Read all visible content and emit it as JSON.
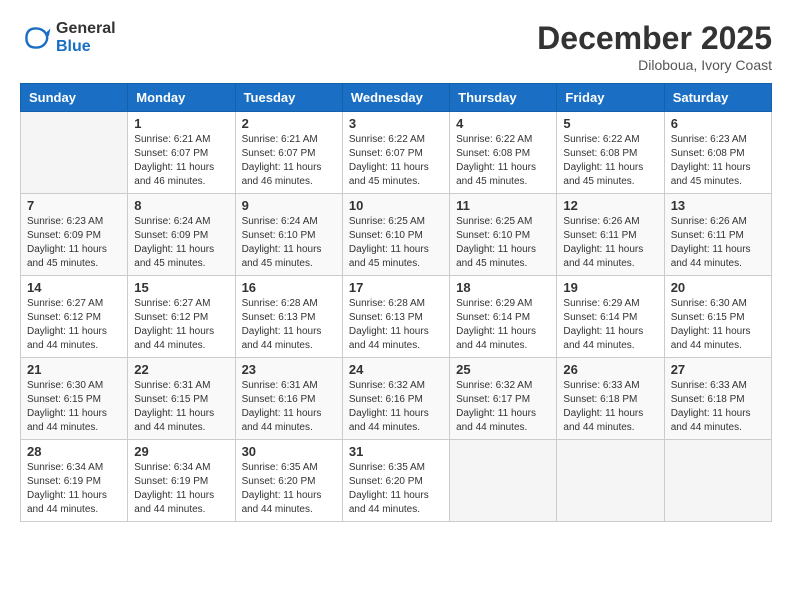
{
  "header": {
    "logo_general": "General",
    "logo_blue": "Blue",
    "month_year": "December 2025",
    "location": "Diloboua, Ivory Coast"
  },
  "columns": [
    "Sunday",
    "Monday",
    "Tuesday",
    "Wednesday",
    "Thursday",
    "Friday",
    "Saturday"
  ],
  "weeks": [
    [
      {
        "day": "",
        "sunrise": "",
        "sunset": "",
        "daylight": ""
      },
      {
        "day": "1",
        "sunrise": "Sunrise: 6:21 AM",
        "sunset": "Sunset: 6:07 PM",
        "daylight": "Daylight: 11 hours and 46 minutes."
      },
      {
        "day": "2",
        "sunrise": "Sunrise: 6:21 AM",
        "sunset": "Sunset: 6:07 PM",
        "daylight": "Daylight: 11 hours and 46 minutes."
      },
      {
        "day": "3",
        "sunrise": "Sunrise: 6:22 AM",
        "sunset": "Sunset: 6:07 PM",
        "daylight": "Daylight: 11 hours and 45 minutes."
      },
      {
        "day": "4",
        "sunrise": "Sunrise: 6:22 AM",
        "sunset": "Sunset: 6:08 PM",
        "daylight": "Daylight: 11 hours and 45 minutes."
      },
      {
        "day": "5",
        "sunrise": "Sunrise: 6:22 AM",
        "sunset": "Sunset: 6:08 PM",
        "daylight": "Daylight: 11 hours and 45 minutes."
      },
      {
        "day": "6",
        "sunrise": "Sunrise: 6:23 AM",
        "sunset": "Sunset: 6:08 PM",
        "daylight": "Daylight: 11 hours and 45 minutes."
      }
    ],
    [
      {
        "day": "7",
        "sunrise": "Sunrise: 6:23 AM",
        "sunset": "Sunset: 6:09 PM",
        "daylight": "Daylight: 11 hours and 45 minutes."
      },
      {
        "day": "8",
        "sunrise": "Sunrise: 6:24 AM",
        "sunset": "Sunset: 6:09 PM",
        "daylight": "Daylight: 11 hours and 45 minutes."
      },
      {
        "day": "9",
        "sunrise": "Sunrise: 6:24 AM",
        "sunset": "Sunset: 6:10 PM",
        "daylight": "Daylight: 11 hours and 45 minutes."
      },
      {
        "day": "10",
        "sunrise": "Sunrise: 6:25 AM",
        "sunset": "Sunset: 6:10 PM",
        "daylight": "Daylight: 11 hours and 45 minutes."
      },
      {
        "day": "11",
        "sunrise": "Sunrise: 6:25 AM",
        "sunset": "Sunset: 6:10 PM",
        "daylight": "Daylight: 11 hours and 45 minutes."
      },
      {
        "day": "12",
        "sunrise": "Sunrise: 6:26 AM",
        "sunset": "Sunset: 6:11 PM",
        "daylight": "Daylight: 11 hours and 44 minutes."
      },
      {
        "day": "13",
        "sunrise": "Sunrise: 6:26 AM",
        "sunset": "Sunset: 6:11 PM",
        "daylight": "Daylight: 11 hours and 44 minutes."
      }
    ],
    [
      {
        "day": "14",
        "sunrise": "Sunrise: 6:27 AM",
        "sunset": "Sunset: 6:12 PM",
        "daylight": "Daylight: 11 hours and 44 minutes."
      },
      {
        "day": "15",
        "sunrise": "Sunrise: 6:27 AM",
        "sunset": "Sunset: 6:12 PM",
        "daylight": "Daylight: 11 hours and 44 minutes."
      },
      {
        "day": "16",
        "sunrise": "Sunrise: 6:28 AM",
        "sunset": "Sunset: 6:13 PM",
        "daylight": "Daylight: 11 hours and 44 minutes."
      },
      {
        "day": "17",
        "sunrise": "Sunrise: 6:28 AM",
        "sunset": "Sunset: 6:13 PM",
        "daylight": "Daylight: 11 hours and 44 minutes."
      },
      {
        "day": "18",
        "sunrise": "Sunrise: 6:29 AM",
        "sunset": "Sunset: 6:14 PM",
        "daylight": "Daylight: 11 hours and 44 minutes."
      },
      {
        "day": "19",
        "sunrise": "Sunrise: 6:29 AM",
        "sunset": "Sunset: 6:14 PM",
        "daylight": "Daylight: 11 hours and 44 minutes."
      },
      {
        "day": "20",
        "sunrise": "Sunrise: 6:30 AM",
        "sunset": "Sunset: 6:15 PM",
        "daylight": "Daylight: 11 hours and 44 minutes."
      }
    ],
    [
      {
        "day": "21",
        "sunrise": "Sunrise: 6:30 AM",
        "sunset": "Sunset: 6:15 PM",
        "daylight": "Daylight: 11 hours and 44 minutes."
      },
      {
        "day": "22",
        "sunrise": "Sunrise: 6:31 AM",
        "sunset": "Sunset: 6:15 PM",
        "daylight": "Daylight: 11 hours and 44 minutes."
      },
      {
        "day": "23",
        "sunrise": "Sunrise: 6:31 AM",
        "sunset": "Sunset: 6:16 PM",
        "daylight": "Daylight: 11 hours and 44 minutes."
      },
      {
        "day": "24",
        "sunrise": "Sunrise: 6:32 AM",
        "sunset": "Sunset: 6:16 PM",
        "daylight": "Daylight: 11 hours and 44 minutes."
      },
      {
        "day": "25",
        "sunrise": "Sunrise: 6:32 AM",
        "sunset": "Sunset: 6:17 PM",
        "daylight": "Daylight: 11 hours and 44 minutes."
      },
      {
        "day": "26",
        "sunrise": "Sunrise: 6:33 AM",
        "sunset": "Sunset: 6:18 PM",
        "daylight": "Daylight: 11 hours and 44 minutes."
      },
      {
        "day": "27",
        "sunrise": "Sunrise: 6:33 AM",
        "sunset": "Sunset: 6:18 PM",
        "daylight": "Daylight: 11 hours and 44 minutes."
      }
    ],
    [
      {
        "day": "28",
        "sunrise": "Sunrise: 6:34 AM",
        "sunset": "Sunset: 6:19 PM",
        "daylight": "Daylight: 11 hours and 44 minutes."
      },
      {
        "day": "29",
        "sunrise": "Sunrise: 6:34 AM",
        "sunset": "Sunset: 6:19 PM",
        "daylight": "Daylight: 11 hours and 44 minutes."
      },
      {
        "day": "30",
        "sunrise": "Sunrise: 6:35 AM",
        "sunset": "Sunset: 6:20 PM",
        "daylight": "Daylight: 11 hours and 44 minutes."
      },
      {
        "day": "31",
        "sunrise": "Sunrise: 6:35 AM",
        "sunset": "Sunset: 6:20 PM",
        "daylight": "Daylight: 11 hours and 44 minutes."
      },
      {
        "day": "",
        "sunrise": "",
        "sunset": "",
        "daylight": ""
      },
      {
        "day": "",
        "sunrise": "",
        "sunset": "",
        "daylight": ""
      },
      {
        "day": "",
        "sunrise": "",
        "sunset": "",
        "daylight": ""
      }
    ]
  ]
}
